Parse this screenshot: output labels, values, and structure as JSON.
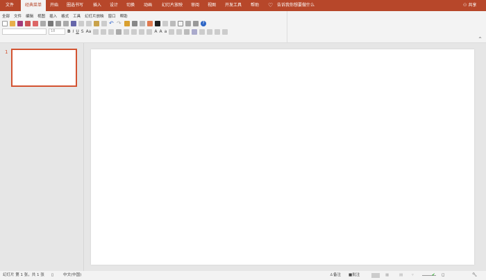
{
  "tabs": [
    "文件",
    "经典菜单",
    "开始",
    "圈选书写",
    "插入",
    "设计",
    "切换",
    "动画",
    "幻灯片放映",
    "审阅",
    "视图",
    "开发工具",
    "帮助"
  ],
  "tell_me": "告诉我你想要做什么",
  "share": "共享",
  "menu": [
    "全部",
    "文件",
    "编辑",
    "视图",
    "插入",
    "格式",
    "工具",
    "幻灯片放映",
    "窗口",
    "帮助"
  ],
  "font_size": "18",
  "slide_number": "1",
  "status": {
    "slide_info": "幻灯片 第 1 张，共 1 张",
    "language": "中文(中国)",
    "notes": "备注",
    "comments": "批注"
  },
  "colors": {
    "accent": "#b7472a",
    "thumb_border": "#d35230"
  }
}
